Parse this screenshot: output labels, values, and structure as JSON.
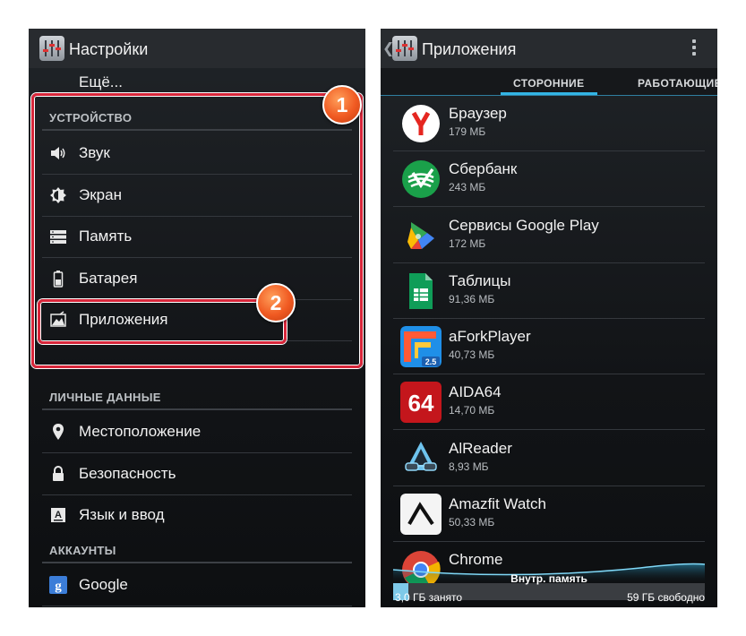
{
  "left_screen": {
    "title": "Настройки",
    "more_label": "Ещё...",
    "sections": {
      "device": "УСТРОЙСТВО",
      "personal": "ЛИЧНЫЕ ДАННЫЕ",
      "accounts": "АККАУНТЫ"
    },
    "device_items": [
      {
        "label": "Звук",
        "icon": "speaker-icon"
      },
      {
        "label": "Экран",
        "icon": "brightness-icon"
      },
      {
        "label": "Память",
        "icon": "storage-icon"
      },
      {
        "label": "Батарея",
        "icon": "battery-icon"
      },
      {
        "label": "Приложения",
        "icon": "apps-icon"
      }
    ],
    "personal_items": [
      {
        "label": "Местоположение",
        "icon": "location-pin-icon"
      },
      {
        "label": "Безопасность",
        "icon": "lock-icon"
      },
      {
        "label": "Язык и ввод",
        "icon": "keyboard-icon"
      }
    ],
    "account_items": [
      {
        "label": "Google",
        "icon": "google-icon"
      }
    ]
  },
  "callouts": [
    "1",
    "2"
  ],
  "right_screen": {
    "title": "Приложения",
    "tabs": [
      "СТОРОННИЕ",
      "РАБОТАЮЩИЕ"
    ],
    "active_tab": "СТОРОННИЕ",
    "apps": [
      {
        "name": "Браузер",
        "size": "179 МБ",
        "icon": "yandex-browser-icon"
      },
      {
        "name": "Сбербанк",
        "size": "243 МБ",
        "icon": "sberbank-icon"
      },
      {
        "name": "Сервисы Google Play",
        "size": "172 МБ",
        "icon": "google-play-services-icon"
      },
      {
        "name": "Таблицы",
        "size": "91,36 МБ",
        "icon": "google-sheets-icon"
      },
      {
        "name": "aForkPlayer",
        "size": "40,73 МБ",
        "icon": "aforkplayer-icon",
        "badge": "2.5"
      },
      {
        "name": "AIDA64",
        "size": "14,70 МБ",
        "icon": "aida64-icon",
        "badge": "64"
      },
      {
        "name": "AlReader",
        "size": "8,93 МБ",
        "icon": "alreader-icon"
      },
      {
        "name": "Amazfit Watch",
        "size": "50,33 МБ",
        "icon": "amazfit-icon"
      },
      {
        "name": "Chrome",
        "size": "",
        "icon": "chrome-icon"
      }
    ],
    "storage": {
      "title": "Внутр. память",
      "used": "3,0 ГБ занято",
      "free": "59 ГБ свободно",
      "used_fraction": 0.05
    }
  },
  "colors": {
    "accent": "#33b5e5",
    "highlight": "#d8263a",
    "callout": "#f05a22"
  }
}
